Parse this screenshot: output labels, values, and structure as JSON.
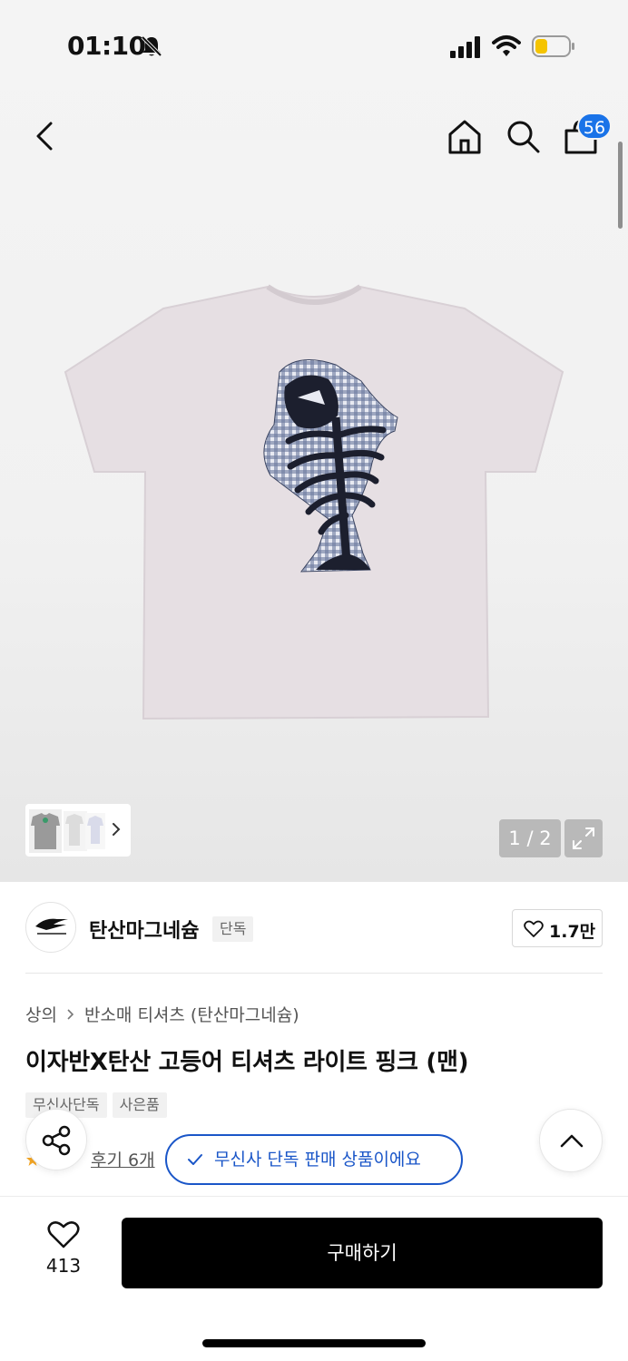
{
  "status": {
    "time": "01:10"
  },
  "nav": {
    "cart_count": "56"
  },
  "gallery": {
    "counter": "1 / 2"
  },
  "brand": {
    "name": "탄산마그네슘",
    "tag": "단독",
    "likes": "1.7만"
  },
  "breadcrumb": {
    "level1": "상의",
    "level2": "반소매 티셔츠 (탄산마그네슘)"
  },
  "product": {
    "title": "이자반X탄산 고등어 티셔츠 라이트 핑크 (맨)",
    "tags": [
      "무신사단독",
      "사은품"
    ],
    "review_link": "후기 6개"
  },
  "notice": {
    "exclusive": "무신사 단독 판매 상품이에요"
  },
  "bottom": {
    "wish_count": "413",
    "buy_label": "구매하기"
  },
  "colors": {
    "accent_blue": "#1a56c8",
    "badge_blue": "#1a73e8",
    "buy_bg": "#000000"
  }
}
